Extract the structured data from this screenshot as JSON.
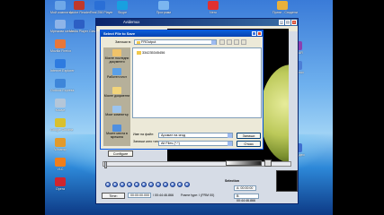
{
  "app_window": {
    "title": "Avidemux"
  },
  "desktop_icons": [
    {
      "label": "Мой компютър",
      "color": "#6fa8e8"
    },
    {
      "label": "Adobe Reader",
      "color": "#c0392b"
    },
    {
      "label": "Real 256 Player",
      "color": "#2a6fd6"
    },
    {
      "label": "Skype",
      "color": "#18a0e0"
    },
    {
      "label": "Програми",
      "color": "#7bb6f0"
    },
    {
      "label": "Nero",
      "color": "#e03030"
    },
    {
      "label": "Прати - Сподели",
      "color": "#e9b13a"
    },
    {
      "label": "Мрежови места",
      "color": "#8fb4e8"
    },
    {
      "label": "Media Player Classic",
      "color": "#2d5fc4"
    },
    {
      "label": "Mozilla Firefox",
      "color": "#e8773a"
    },
    {
      "label": "Internet Explorer",
      "color": "#2e7be0"
    },
    {
      "label": "Outlook Express",
      "color": "#3e86d9"
    },
    {
      "label": "Кошче",
      "color": "#b4c6d8"
    },
    {
      "label": "Google Chrome",
      "color": "#d9c02e"
    },
    {
      "label": "Winamp",
      "color": "#e29a2b"
    },
    {
      "label": "VLC",
      "color": "#f07e1a"
    },
    {
      "label": "Opera",
      "color": "#d0252d"
    },
    {
      "label": "WinRAR",
      "color": "#8b3fb0"
    },
    {
      "label": "Avidemux",
      "color": "#4c7ed6"
    },
    {
      "label": "Акт Видео",
      "color": "#3f6fd0"
    }
  ],
  "dialog": {
    "title": "Select File to Save",
    "save_in_label": "Запиши в:",
    "save_in_value": "FROutput",
    "places": [
      {
        "label": "Моите последни документи",
        "color": "#f0c36a"
      },
      {
        "label": "Работен плот",
        "color": "#5aa0e8"
      },
      {
        "label": "Моите документи",
        "color": "#f2d47a"
      },
      {
        "label": "Моят компютър",
        "color": "#9cc4ee"
      },
      {
        "label": "Моите места в мрежата",
        "color": "#4f8fe0"
      }
    ],
    "files": [
      "334235345456"
    ],
    "filename_label": "Име на файл:",
    "filename_value": "Аромат на ягод",
    "filetype_label": "Запиши като тип:",
    "filetype_value": "All Files (*.*)",
    "save_button": "Запиши",
    "cancel_button": "Отказ"
  },
  "controls": {
    "configure": "Configure",
    "time_button": "Time:",
    "current_time": "00:00:00.000",
    "total_time": "/ 00:44:46.866",
    "frame_type": "Frame type: I (FRM 00)",
    "selection_label": "Selection",
    "selection_a": "A: 00:00:00",
    "selection_b": "B: 00:44:46.866"
  }
}
